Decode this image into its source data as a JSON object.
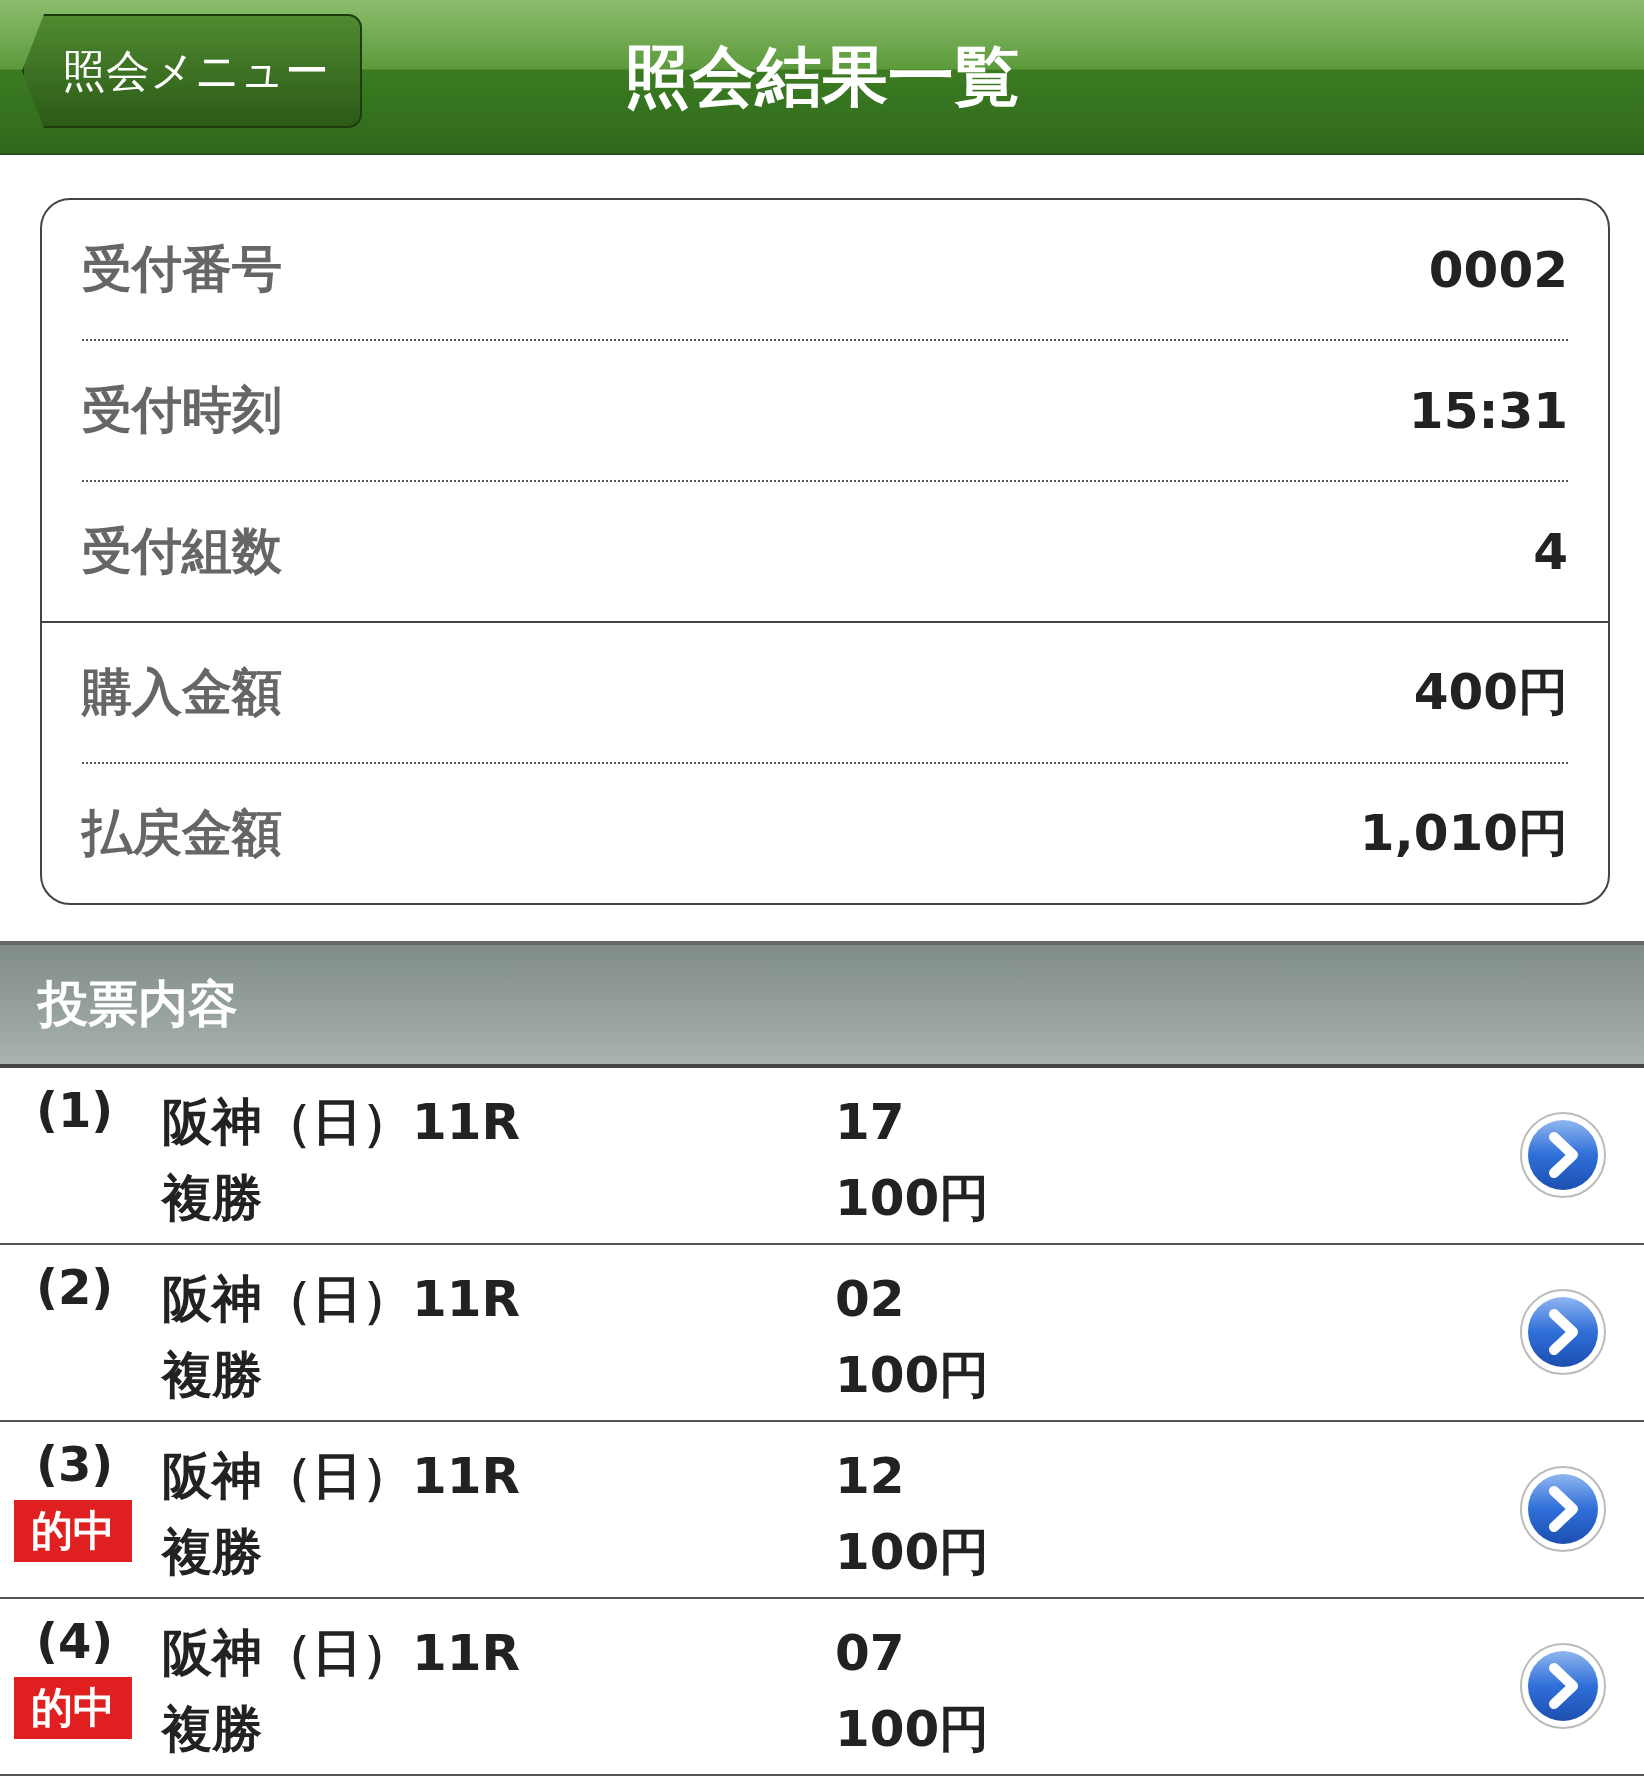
{
  "header": {
    "back_button": "照会メニュー",
    "title": "照会結果一覧"
  },
  "summary": {
    "groups": [
      [
        {
          "label": "受付番号",
          "value": "0002"
        },
        {
          "label": "受付時刻",
          "value": "15:31"
        },
        {
          "label": "受付組数",
          "value": "4"
        }
      ],
      [
        {
          "label": "購入金額",
          "value": "400円"
        },
        {
          "label": "払戻金額",
          "value": "1,010円"
        }
      ]
    ]
  },
  "section_title": "投票内容",
  "bets": [
    {
      "number": "(1)",
      "race": "阪神（日）11R",
      "bet_type": "複勝",
      "horse": "17",
      "amount": "100円"
    },
    {
      "number": "(2)",
      "race": "阪神（日）11R",
      "bet_type": "複勝",
      "horse": "02",
      "amount": "100円"
    },
    {
      "number": "(3)",
      "badge": "的中",
      "race": "阪神（日）11R",
      "bet_type": "複勝",
      "horse": "12",
      "amount": "100円"
    },
    {
      "number": "(4)",
      "badge": "的中",
      "race": "阪神（日）11R",
      "bet_type": "複勝",
      "horse": "07",
      "amount": "100円"
    }
  ]
}
